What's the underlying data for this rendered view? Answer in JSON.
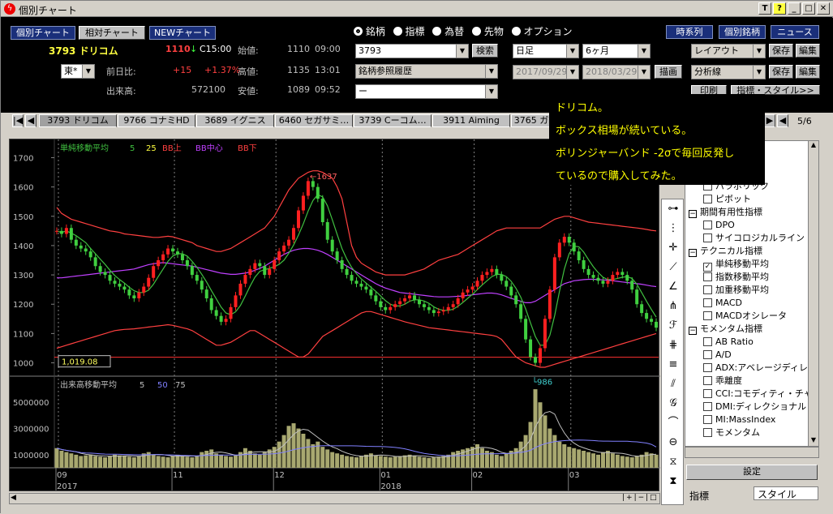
{
  "window": {
    "title": "個別チャート",
    "controls": [
      "T",
      "?",
      "_",
      "□",
      "✕"
    ]
  },
  "nav_buttons": [
    "個別チャート",
    "相対チャート",
    "NEWチャート"
  ],
  "right_buttons": [
    "時系列",
    "個別銘柄",
    "ニュース"
  ],
  "stock": {
    "code_name": "3793 ドリコム",
    "price": "1110",
    "arrow": "↓",
    "time": "C15:00",
    "market": "東*",
    "prev_label": "前日比:",
    "change": "+15",
    "change_pct": "+1.37%",
    "volume_label": "出来高:",
    "volume": "572100",
    "open_label": "始値:",
    "open": "1110",
    "open_time": "09:00",
    "high_label": "高値:",
    "high": "1135",
    "high_time": "13:01",
    "low_label": "安値:",
    "low": "1089",
    "low_time": "09:52"
  },
  "radios": [
    {
      "label": "銘柄",
      "checked": true
    },
    {
      "label": "指標",
      "checked": false
    },
    {
      "label": "為替",
      "checked": false
    },
    {
      "label": "先物",
      "checked": false
    },
    {
      "label": "オプション",
      "checked": false
    }
  ],
  "search": {
    "value": "3793",
    "button": "検索",
    "history": "銘柄参照履歴",
    "third": "ー"
  },
  "period": {
    "unit": "日足",
    "range": "6ヶ月",
    "from": "2017/09/29",
    "to": "2018/03/29",
    "draw": "描画"
  },
  "layout": {
    "layout_label": "レイアウト",
    "save": "保存",
    "edit": "編集",
    "analysis_label": "分析線",
    "print": "印刷",
    "indicator_style": "指標・スタイル>>"
  },
  "tabs": [
    "3793 ドリコム",
    "9766 コナミHD",
    "3689 イグニス",
    "6460 セガサミ…",
    "3739 Cーコム…",
    "3911 Aiming",
    "3765 ガ"
  ],
  "tabs_page": "5/6",
  "tooltip": {
    "lines": [
      "ドリコム。",
      "ボックス相場が続いている。",
      "ボリンジャーバンド -2σで毎回反発し",
      "ているので購入してみた。"
    ]
  },
  "chart_data": [
    {
      "type": "candlestick",
      "legend": [
        {
          "name": "単純移動平均",
          "color": "#40c040"
        },
        {
          "name": "5",
          "color": "#40c040"
        },
        {
          "name": "25",
          "color": "#ffff40"
        },
        {
          "name": "BB上",
          "color": "#ff4040"
        },
        {
          "name": "BB中心",
          "color": "#c040ff"
        },
        {
          "name": "BB下",
          "color": "#ff4040"
        }
      ],
      "y_ticks": [
        1700,
        1600,
        1500,
        1400,
        1300,
        1200,
        1100,
        1000
      ],
      "ylim": [
        960,
        1740
      ],
      "annotations": [
        {
          "text": "1637",
          "value": 1637
        },
        {
          "text": "986",
          "value": 986
        }
      ],
      "current_label": "1,019.08",
      "close": [
        1450,
        1440,
        1460,
        1420,
        1400,
        1390,
        1380,
        1360,
        1330,
        1310,
        1300,
        1280,
        1270,
        1260,
        1250,
        1230,
        1220,
        1240,
        1260,
        1290,
        1330,
        1350,
        1370,
        1390,
        1380,
        1370,
        1350,
        1330,
        1300,
        1280,
        1250,
        1220,
        1180,
        1160,
        1140,
        1150,
        1190,
        1230,
        1270,
        1300,
        1320,
        1340,
        1330,
        1300,
        1320,
        1350,
        1380,
        1400,
        1420,
        1460,
        1520,
        1570,
        1620,
        1600,
        1560,
        1480,
        1420,
        1380,
        1350,
        1320,
        1300,
        1280,
        1270,
        1260,
        1250,
        1230,
        1210,
        1190,
        1180,
        1190,
        1200,
        1210,
        1220,
        1230,
        1215,
        1200,
        1190,
        1180,
        1170,
        1175,
        1180,
        1190,
        1200,
        1220,
        1240,
        1250,
        1260,
        1280,
        1300,
        1310,
        1320,
        1300,
        1280,
        1260,
        1230,
        1200,
        1150,
        1080,
        1020,
        1000,
        1050,
        1150,
        1250,
        1360,
        1410,
        1430,
        1410,
        1380,
        1350,
        1320,
        1300,
        1290,
        1280,
        1270,
        1280,
        1300,
        1310,
        1300,
        1280,
        1250,
        1200,
        1170,
        1150,
        1140,
        1120
      ],
      "bb_upper": [
        1530,
        1510,
        1500,
        1490,
        1485,
        1480,
        1475,
        1470,
        1465,
        1460,
        1455,
        1450,
        1448,
        1445,
        1440,
        1438,
        1436,
        1434,
        1432,
        1430,
        1428,
        1428,
        1430,
        1432,
        1430,
        1425,
        1420,
        1415,
        1410,
        1400,
        1395,
        1390,
        1385,
        1380,
        1380,
        1385,
        1390,
        1400,
        1410,
        1420,
        1430,
        1440,
        1450,
        1460,
        1480,
        1500,
        1530,
        1560,
        1590,
        1610,
        1630,
        1640,
        1650,
        1655,
        1655,
        1650,
        1640,
        1630,
        1600,
        1560,
        1480,
        1400,
        1360,
        1340,
        1330,
        1320,
        1310,
        1305,
        1300,
        1300,
        1300,
        1300,
        1300,
        1305,
        1310,
        1315,
        1320,
        1330,
        1340,
        1350,
        1355,
        1360,
        1365,
        1370,
        1380,
        1390,
        1400,
        1410,
        1420,
        1430,
        1440,
        1450,
        1455,
        1460,
        1460,
        1460,
        1460,
        1460,
        1460,
        1460,
        1460,
        1470,
        1480,
        1490,
        1495,
        1500,
        1500,
        1495,
        1490,
        1485,
        1480,
        1478,
        1476,
        1474,
        1472,
        1470,
        1468,
        1466,
        1464,
        1462,
        1460,
        1458,
        1455,
        1452,
        1450
      ],
      "bb_mid": [
        1290,
        1290,
        1292,
        1294,
        1296,
        1298,
        1300,
        1302,
        1304,
        1306,
        1308,
        1310,
        1312,
        1314,
        1316,
        1318,
        1320,
        1325,
        1330,
        1335,
        1338,
        1340,
        1342,
        1340,
        1338,
        1336,
        1334,
        1332,
        1330,
        1326,
        1322,
        1318,
        1314,
        1310,
        1306,
        1304,
        1302,
        1302,
        1304,
        1306,
        1310,
        1316,
        1322,
        1330,
        1340,
        1350,
        1360,
        1370,
        1378,
        1384,
        1388,
        1390,
        1390,
        1388,
        1384,
        1378,
        1370,
        1360,
        1350,
        1340,
        1330,
        1320,
        1310,
        1300,
        1290,
        1280,
        1270,
        1262,
        1255,
        1250,
        1245,
        1240,
        1238,
        1236,
        1234,
        1232,
        1230,
        1228,
        1226,
        1225,
        1225,
        1225,
        1226,
        1227,
        1228,
        1230,
        1232,
        1234,
        1236,
        1238,
        1238,
        1236,
        1232,
        1226,
        1220,
        1215,
        1210,
        1205,
        1205,
        1210,
        1220,
        1230,
        1240,
        1250,
        1260,
        1270,
        1275,
        1280,
        1282,
        1284,
        1285,
        1285,
        1284,
        1283,
        1282,
        1280,
        1278,
        1276,
        1274,
        1272,
        1270,
        1268,
        1265,
        1262,
        1260
      ],
      "bb_lower": [
        1050,
        1055,
        1060,
        1065,
        1070,
        1075,
        1080,
        1085,
        1090,
        1095,
        1100,
        1105,
        1110,
        1112,
        1114,
        1115,
        1116,
        1118,
        1120,
        1122,
        1124,
        1126,
        1128,
        1130,
        1128,
        1124,
        1120,
        1116,
        1110,
        1100,
        1090,
        1080,
        1070,
        1060,
        1060,
        1065,
        1070,
        1080,
        1090,
        1100,
        1110,
        1110,
        1100,
        1090,
        1080,
        1070,
        1060,
        1050,
        1040,
        1030,
        1020,
        1020,
        1030,
        1050,
        1070,
        1090,
        1100,
        1110,
        1120,
        1130,
        1140,
        1150,
        1160,
        1170,
        1175,
        1175,
        1170,
        1165,
        1160,
        1155,
        1150,
        1145,
        1140,
        1136,
        1132,
        1128,
        1124,
        1120,
        1118,
        1116,
        1114,
        1112,
        1110,
        1108,
        1106,
        1104,
        1102,
        1100,
        1098,
        1096,
        1094,
        1090,
        1080,
        1060,
        1040,
        1020,
        1010,
        1000,
        995,
        990,
        985,
        985,
        990,
        995,
        1000,
        1005,
        1010,
        1015,
        1020,
        1025,
        1030,
        1035,
        1040,
        1045,
        1050,
        1055,
        1060,
        1065,
        1070,
        1075,
        1080,
        1085,
        1090,
        1095,
        1100
      ]
    },
    {
      "type": "bar",
      "legend": [
        {
          "name": "出来高移動平均",
          "color": "#c0c0c0"
        },
        {
          "name": "5",
          "color": "#c0c0c0"
        },
        {
          "name": "50",
          "color": "#8080ff"
        },
        {
          "name": "75",
          "color": "#c0c0c0"
        }
      ],
      "y_ticks": [
        "5000000",
        "3000000",
        "1000000"
      ],
      "ylim": [
        0,
        6500000
      ],
      "values": [
        1500000,
        1300000,
        1200000,
        1100000,
        1000000,
        900000,
        950000,
        1000000,
        900000,
        850000,
        800000,
        900000,
        1000000,
        950000,
        900000,
        850000,
        800000,
        900000,
        1100000,
        1200000,
        1000000,
        900000,
        850000,
        800000,
        900000,
        1000000,
        950000,
        850000,
        800000,
        900000,
        1200000,
        1300000,
        1400000,
        1100000,
        1000000,
        900000,
        850000,
        950000,
        1200000,
        1500000,
        1300000,
        1100000,
        1000000,
        1200000,
        1400000,
        1600000,
        2000000,
        2500000,
        3200000,
        3400000,
        3000000,
        2600000,
        2200000,
        1800000,
        2000000,
        1600000,
        1400000,
        1200000,
        1100000,
        1000000,
        900000,
        850000,
        800000,
        900000,
        1000000,
        1100000,
        950000,
        900000,
        850000,
        800000,
        850000,
        900000,
        950000,
        1000000,
        900000,
        850000,
        800000,
        750000,
        800000,
        850000,
        900000,
        1000000,
        1200000,
        1300000,
        1400000,
        1500000,
        1600000,
        1800000,
        1500000,
        1300000,
        1200000,
        1000000,
        900000,
        1100000,
        1300000,
        1500000,
        2000000,
        2500000,
        3500000,
        6000000,
        5000000,
        4000000,
        3000000,
        2500000,
        2000000,
        1800000,
        1600000,
        1500000,
        1400000,
        1300000,
        1200000,
        1100000,
        1000000,
        1200000,
        1300000,
        1100000,
        1000000,
        900000,
        850000,
        800000,
        900000,
        1000000,
        1200000,
        1100000,
        1000000
      ]
    }
  ],
  "x_axis": {
    "months": [
      "09",
      "11",
      "12",
      "01",
      "02",
      "03"
    ],
    "years": [
      "2017",
      "2018"
    ]
  },
  "side_panel": {
    "partial_rows": [
      "プ",
      "ーバンド"
    ],
    "items": [
      {
        "kind": "item",
        "label": "パラボリック",
        "checked": false
      },
      {
        "kind": "item",
        "label": "ピボット",
        "checked": false
      },
      {
        "kind": "category",
        "label": "期間有用性指標"
      },
      {
        "kind": "item",
        "label": "DPO",
        "checked": false
      },
      {
        "kind": "item",
        "label": "サイコロジカルライン",
        "checked": false
      },
      {
        "kind": "category",
        "label": "テクニカル指標"
      },
      {
        "kind": "item",
        "label": "単純移動平均",
        "checked": true
      },
      {
        "kind": "item",
        "label": "指数移動平均",
        "checked": false
      },
      {
        "kind": "item",
        "label": "加重移動平均",
        "checked": false
      },
      {
        "kind": "item",
        "label": "MACD",
        "checked": false
      },
      {
        "kind": "item",
        "label": "MACDオシレータ",
        "checked": false
      },
      {
        "kind": "category",
        "label": "モメンタム指標"
      },
      {
        "kind": "item",
        "label": "AB Ratio",
        "checked": false
      },
      {
        "kind": "item",
        "label": "A/D",
        "checked": false
      },
      {
        "kind": "item",
        "label": "ADX:アベレージディレ",
        "checked": false
      },
      {
        "kind": "item",
        "label": "乖離度",
        "checked": false
      },
      {
        "kind": "item",
        "label": "CCI:コモディティ・チャ",
        "checked": false
      },
      {
        "kind": "item",
        "label": "DMI:ディレクショナル",
        "checked": false
      },
      {
        "kind": "item",
        "label": "MI:MassIndex",
        "checked": false
      },
      {
        "kind": "item",
        "label": "モメンタム",
        "checked": false
      }
    ],
    "settings_button": "設定",
    "tab_indicator": "指標",
    "tab_style": "スタイル"
  }
}
